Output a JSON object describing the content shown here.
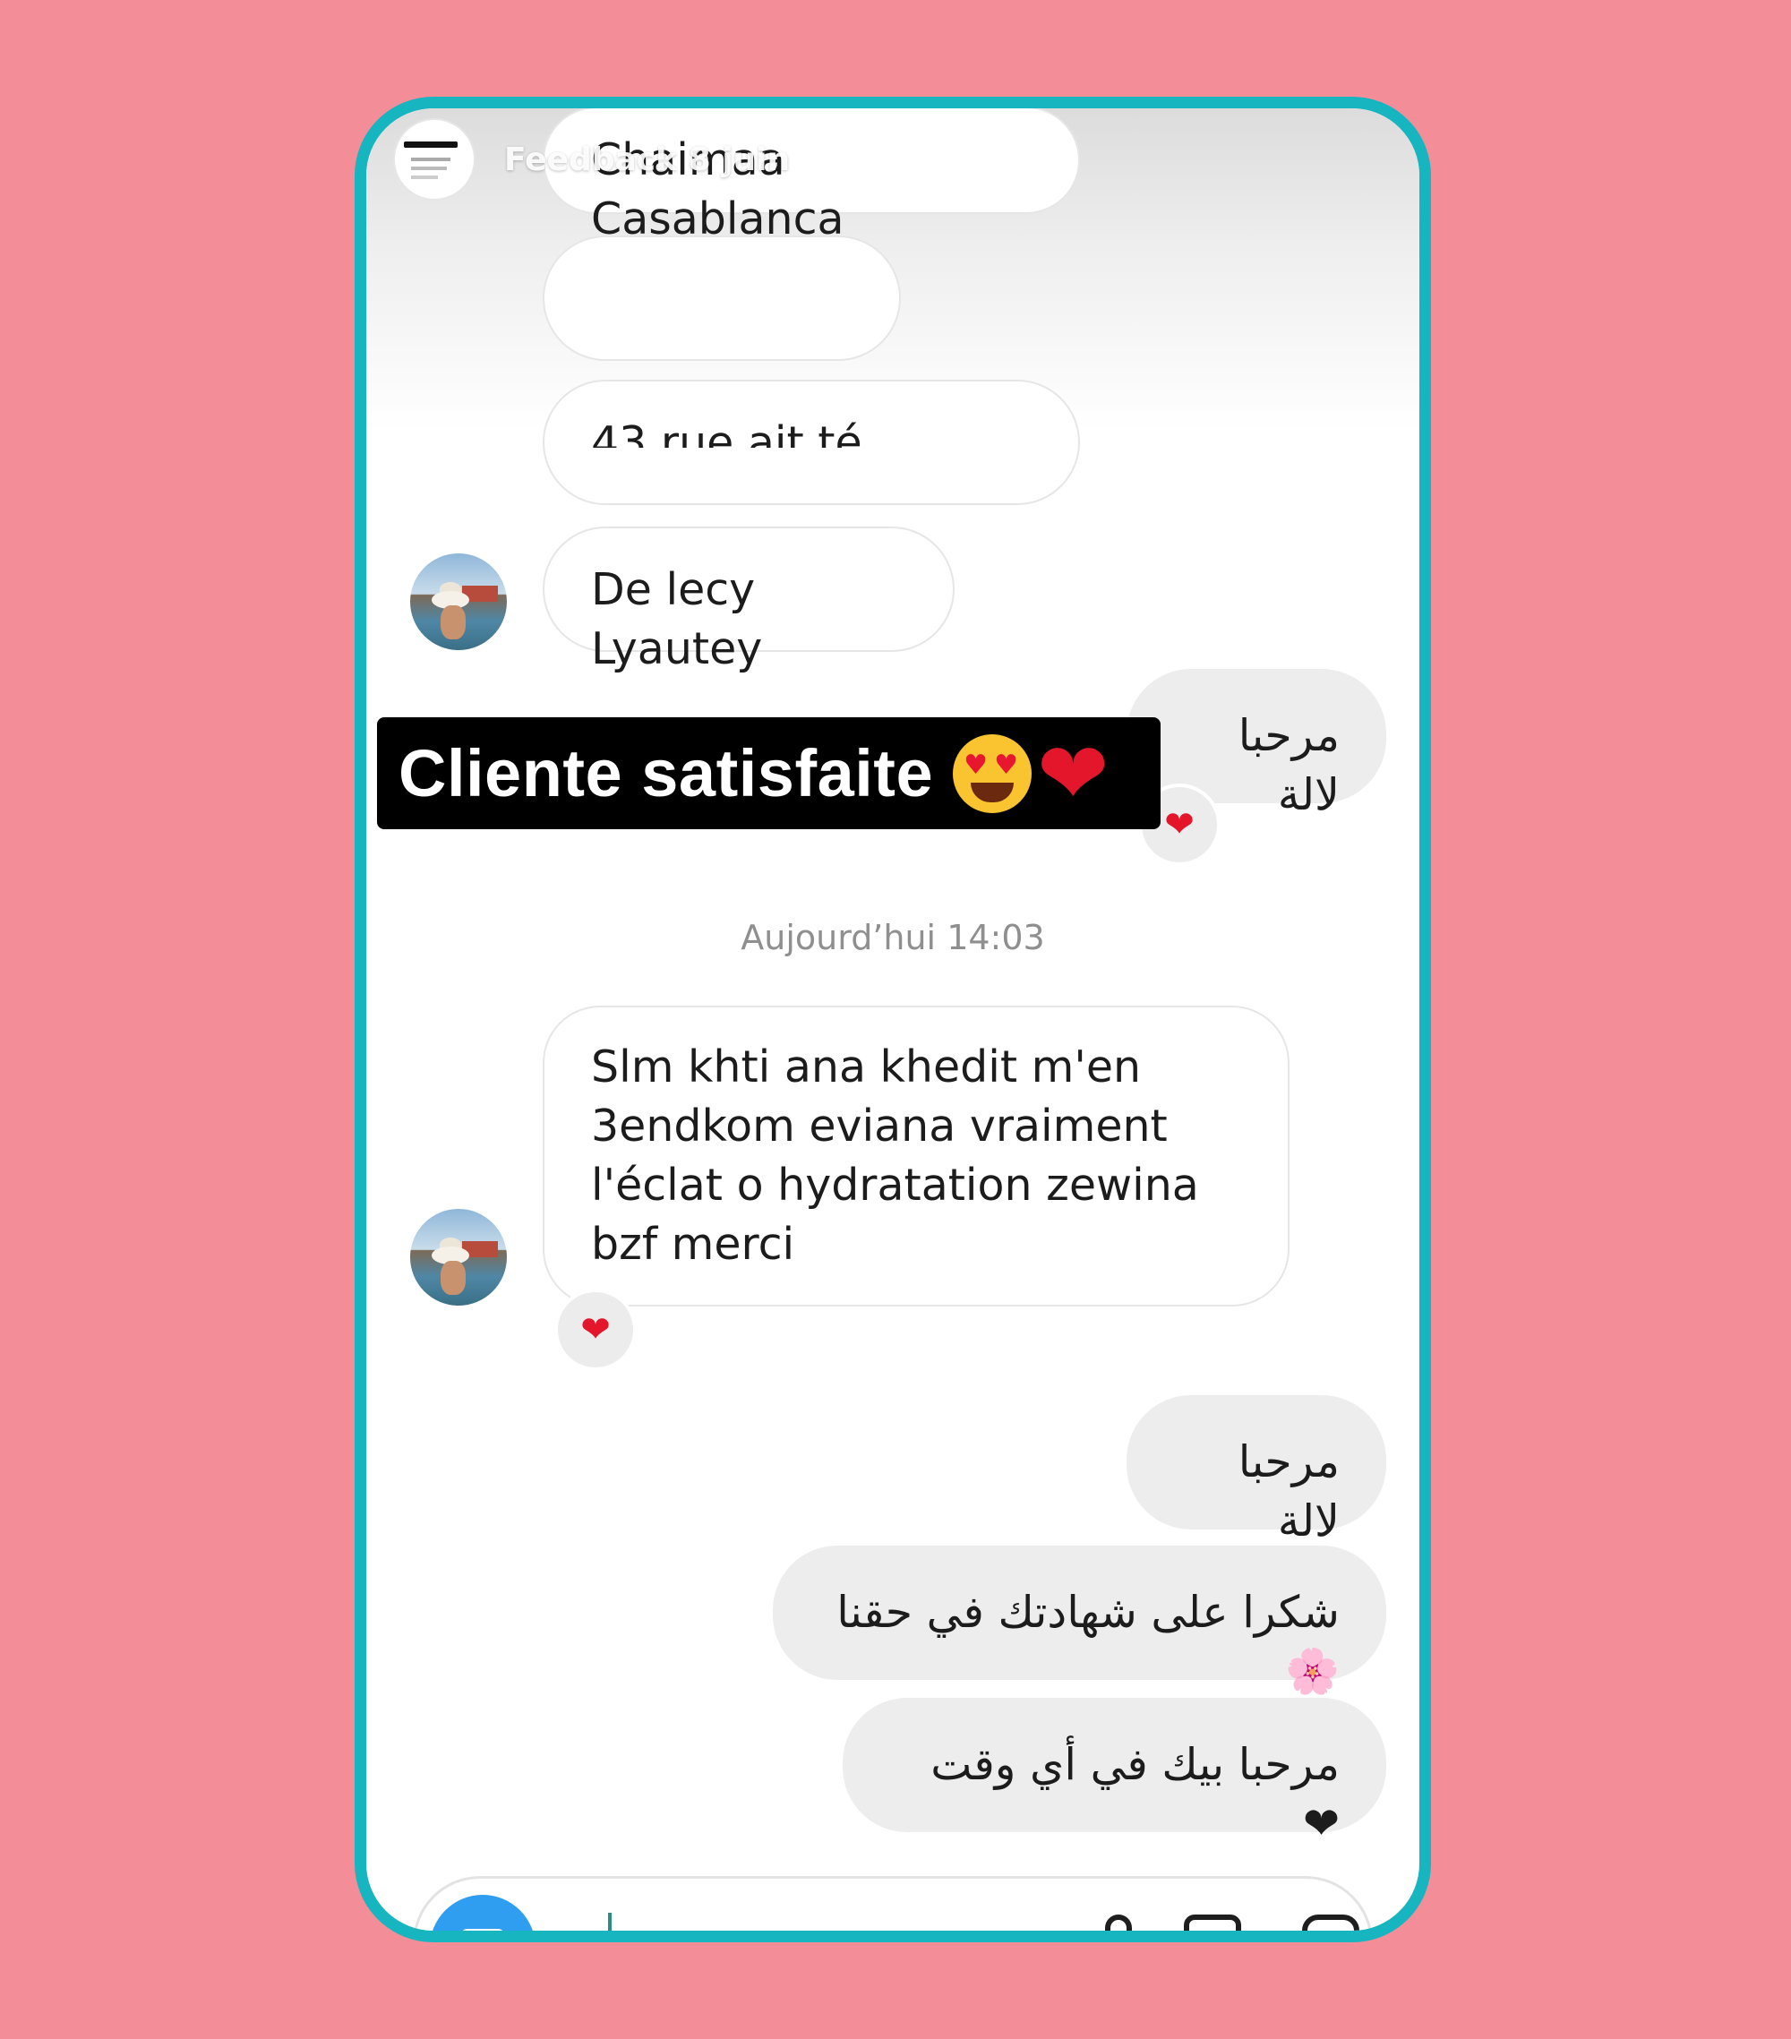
{
  "story": {
    "title": "Feedback 8 juin"
  },
  "messages": {
    "m1": "Chaimaa Casablanca",
    "m2": "",
    "m3": "43 rue ait                    té",
    "m4": "De lecy Lyautey",
    "m5": "مرحبا لالة",
    "m6": "Slm khti ana khedit m'en 3endkom eviana vraiment l'éclat o hydratation zewina bzf merci",
    "m7": "مرحبا لالة",
    "m8": "شكرا على شهادتك في حقنا 🌸",
    "m9": "مرحبا بيك في أي وقت ❤"
  },
  "reactions": {
    "r1": "❤",
    "r2": "❤"
  },
  "overlay": {
    "text": "Cliente satisfaite",
    "heart": "❤"
  },
  "timestamp": "Aujourd’hui 14:03",
  "icons": {
    "camera": "camera-icon",
    "mic": "microphone-icon",
    "gallery": "gallery-icon",
    "sticker": "sticker-icon",
    "heart": "heart-icon"
  },
  "colors": {
    "background": "#f38e99",
    "frame": "#16b5bf",
    "overlay_bg": "#000000",
    "outgoing_bubble": "#ededed",
    "heart": "#e3162b",
    "camera_button": "#2f9df0"
  }
}
